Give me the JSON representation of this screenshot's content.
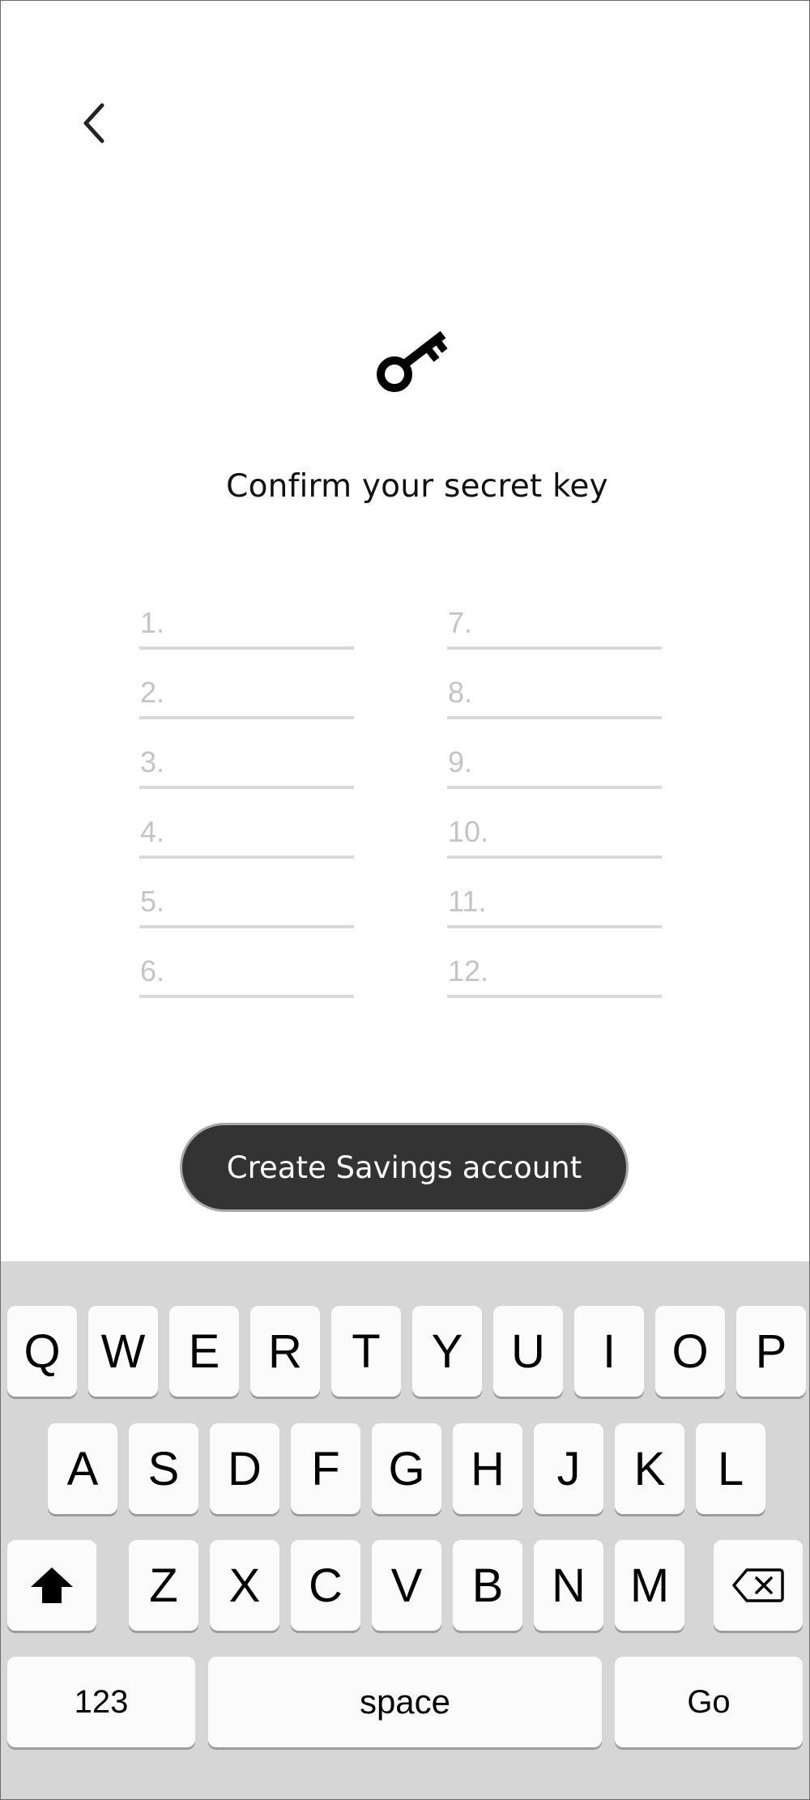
{
  "screen": {
    "title": "Confirm your secret key",
    "cta_label": "Create Savings account"
  },
  "icons": {
    "back": "chevron-left-icon",
    "key": "key-icon",
    "shift": "shift-arrow-icon",
    "backspace": "backspace-icon"
  },
  "secret_words": {
    "left": [
      "1.",
      "2.",
      "3.",
      "4.",
      "5.",
      "6."
    ],
    "right": [
      "7.",
      "8.",
      "9.",
      "10.",
      "11.",
      "12."
    ]
  },
  "keyboard": {
    "row1": [
      "Q",
      "W",
      "E",
      "R",
      "T",
      "Y",
      "U",
      "I",
      "O",
      "P"
    ],
    "row2": [
      "A",
      "S",
      "D",
      "F",
      "G",
      "H",
      "J",
      "K",
      "L"
    ],
    "row3": [
      "Z",
      "X",
      "C",
      "V",
      "B",
      "N",
      "M"
    ],
    "numbers_label": "123",
    "space_label": "space",
    "go_label": "Go"
  },
  "colors": {
    "button_bg": "#333333",
    "keyboard_bg": "#d6d6d6",
    "placeholder": "#c4c4c4"
  }
}
